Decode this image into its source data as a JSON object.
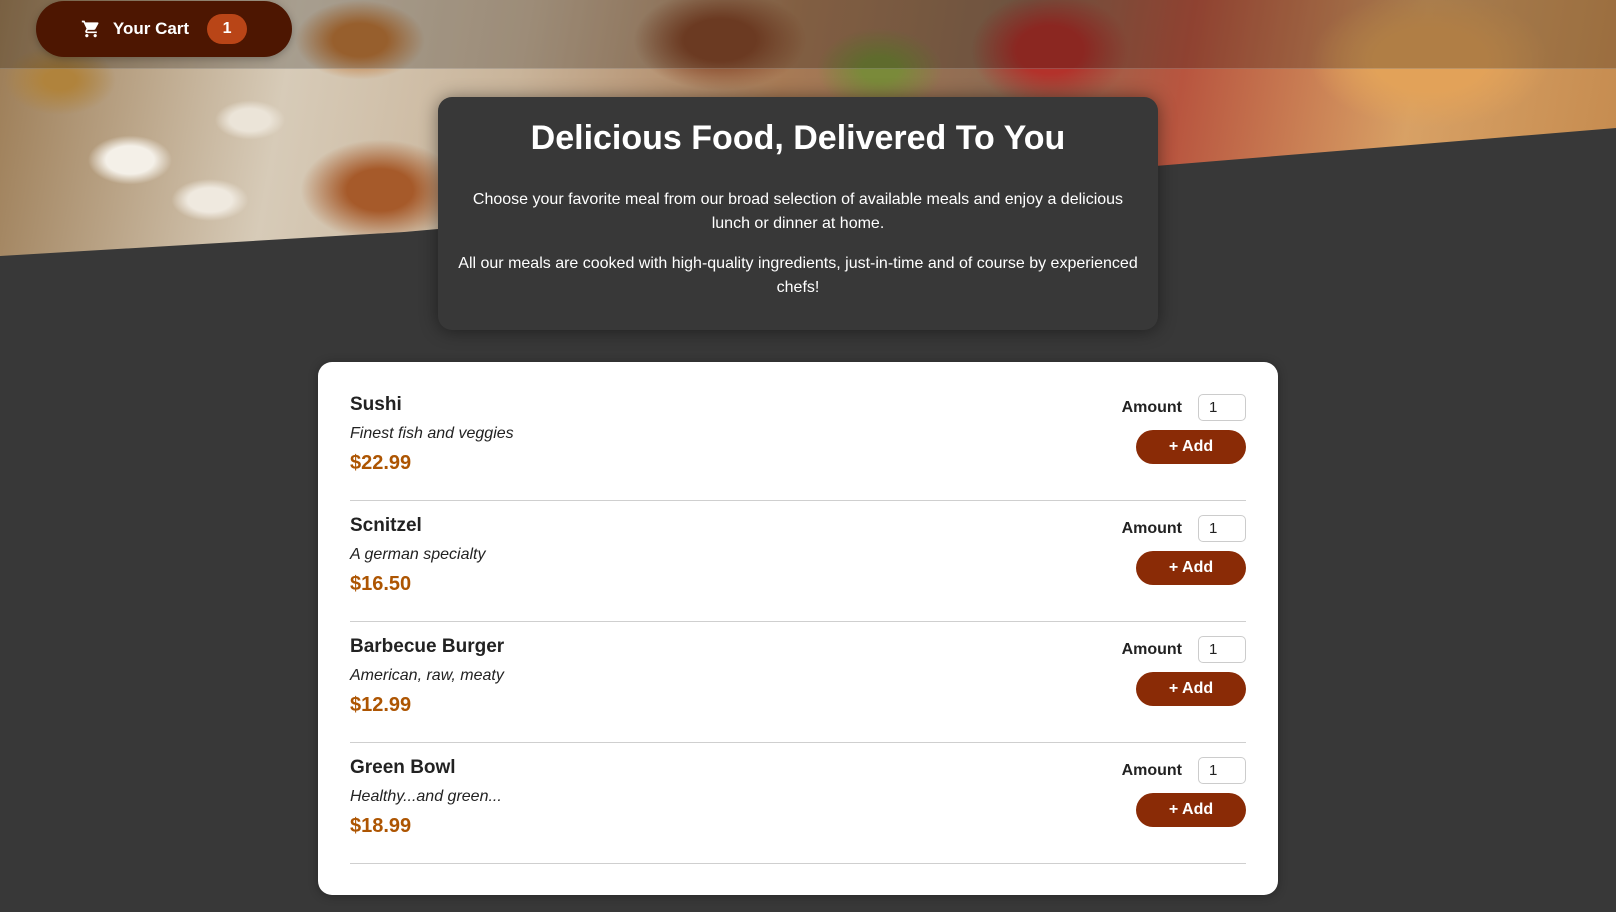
{
  "header": {
    "cart_label": "Your Cart",
    "cart_count": "1"
  },
  "summary": {
    "title": "Delicious Food, Delivered To You",
    "paragraph_1": "Choose your favorite meal from our broad selection of available meals and enjoy a delicious lunch or dinner at home.",
    "paragraph_2": "All our meals are cooked with high-quality ingredients, just-in-time and of course by experienced chefs!"
  },
  "meals": [
    {
      "name": "Sushi",
      "description": "Finest fish and veggies",
      "price": "$22.99",
      "amount_label": "Amount",
      "amount_value": "1",
      "add_label": "+ Add"
    },
    {
      "name": "Scnitzel",
      "description": "A german specialty",
      "price": "$16.50",
      "amount_label": "Amount",
      "amount_value": "1",
      "add_label": "+ Add"
    },
    {
      "name": "Barbecue Burger",
      "description": "American, raw, meaty",
      "price": "$12.99",
      "amount_label": "Amount",
      "amount_value": "1",
      "add_label": "+ Add"
    },
    {
      "name": "Green Bowl",
      "description": "Healthy...and green...",
      "price": "$18.99",
      "amount_label": "Amount",
      "amount_value": "1",
      "add_label": "+ Add"
    }
  ],
  "icons": {
    "cart": "shopping-cart-icon"
  },
  "colors": {
    "background": "#383838",
    "cart_button": "#4d1601",
    "cart_badge": "#b94517",
    "add_button": "#8a2b06",
    "price": "#ad5502"
  }
}
